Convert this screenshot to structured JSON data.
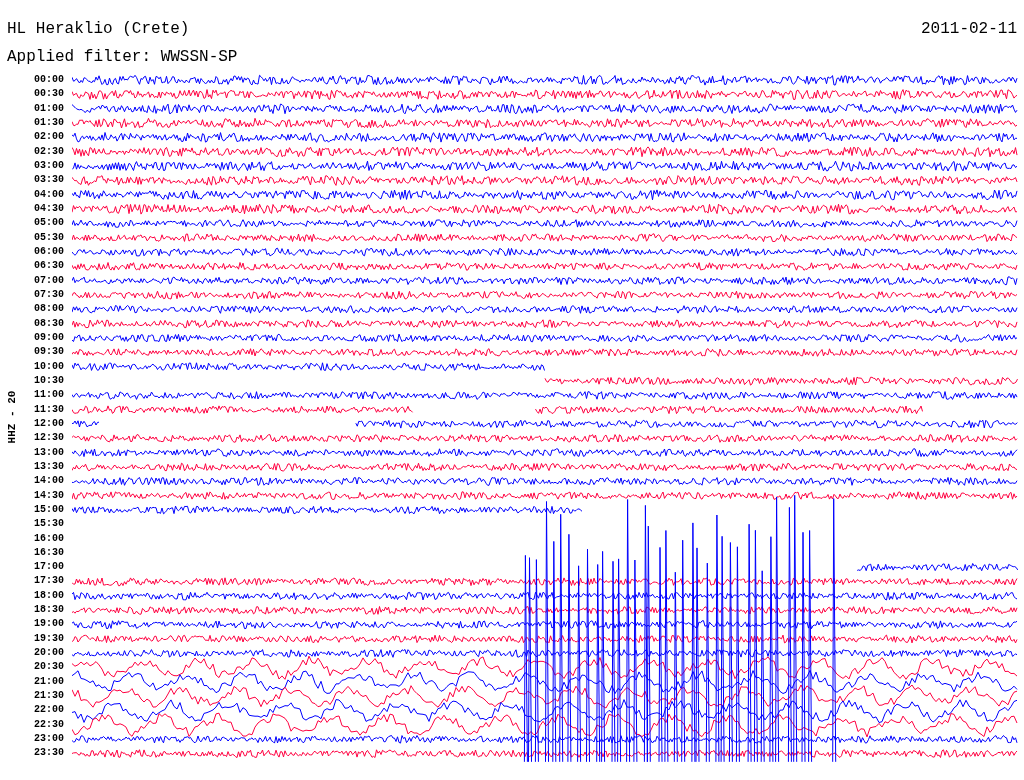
{
  "header": {
    "station": "HL Heraklio (Crete)",
    "date": "2011-02-11",
    "filter": "Applied filter: WWSSN-SP"
  },
  "channel_label": "HHZ - 20",
  "rows": [
    {
      "time": "00:00",
      "color": "#0000ff",
      "kind": "full"
    },
    {
      "time": "00:30",
      "color": "#ff0040",
      "kind": "full"
    },
    {
      "time": "01:00",
      "color": "#0000ff",
      "kind": "full"
    },
    {
      "time": "01:30",
      "color": "#ff0040",
      "kind": "full"
    },
    {
      "time": "02:00",
      "color": "#0000ff",
      "kind": "full"
    },
    {
      "time": "02:30",
      "color": "#ff0040",
      "kind": "full"
    },
    {
      "time": "03:00",
      "color": "#0000ff",
      "kind": "full"
    },
    {
      "time": "03:30",
      "color": "#ff0040",
      "kind": "full"
    },
    {
      "time": "04:00",
      "color": "#0000ff",
      "kind": "full"
    },
    {
      "time": "04:30",
      "color": "#ff0040",
      "kind": "full"
    },
    {
      "time": "05:00",
      "color": "#0000ff",
      "kind": "full"
    },
    {
      "time": "05:30",
      "color": "#ff0040",
      "kind": "full"
    },
    {
      "time": "06:00",
      "color": "#0000ff",
      "kind": "full"
    },
    {
      "time": "06:30",
      "color": "#ff0040",
      "kind": "full"
    },
    {
      "time": "07:00",
      "color": "#0000ff",
      "kind": "full"
    },
    {
      "time": "07:30",
      "color": "#ff0040",
      "kind": "full"
    },
    {
      "time": "08:00",
      "color": "#0000ff",
      "kind": "full"
    },
    {
      "time": "08:30",
      "color": "#ff0040",
      "kind": "full"
    },
    {
      "time": "09:00",
      "color": "#0000ff",
      "kind": "full"
    },
    {
      "time": "09:30",
      "color": "#ff0040",
      "kind": "full"
    },
    {
      "time": "10:00",
      "color": "#0000ff",
      "kind": "partial"
    },
    {
      "time": "10:30",
      "color": "#ff0040",
      "kind": "partial"
    },
    {
      "time": "11:00",
      "color": "#0000ff",
      "kind": "full"
    },
    {
      "time": "11:30",
      "color": "#ff0040",
      "kind": "partial"
    },
    {
      "time": "12:00",
      "color": "#0000ff",
      "kind": "partial"
    },
    {
      "time": "12:30",
      "color": "#ff0040",
      "kind": "full"
    },
    {
      "time": "13:00",
      "color": "#0000ff",
      "kind": "full"
    },
    {
      "time": "13:30",
      "color": "#ff0040",
      "kind": "full"
    },
    {
      "time": "14:00",
      "color": "#0000ff",
      "kind": "full"
    },
    {
      "time": "14:30",
      "color": "#ff0040",
      "kind": "full"
    },
    {
      "time": "15:00",
      "color": "#0000ff",
      "kind": "partial"
    },
    {
      "time": "15:30"
    },
    {
      "time": "16:00"
    },
    {
      "time": "16:30"
    },
    {
      "time": "17:00",
      "color": "#0000ff",
      "kind": "partial"
    },
    {
      "time": "17:30",
      "color": "#ff0040",
      "kind": "full"
    },
    {
      "time": "18:00",
      "color": "#0000ff",
      "kind": "full"
    },
    {
      "time": "18:30",
      "color": "#ff0040",
      "kind": "full"
    },
    {
      "time": "19:00",
      "color": "#0000ff",
      "kind": "full"
    },
    {
      "time": "19:30",
      "color": "#ff0040",
      "kind": "full"
    },
    {
      "time": "20:00",
      "color": "#0000ff",
      "kind": "full"
    },
    {
      "time": "20:30",
      "color": "#ff0040",
      "kind": "full"
    },
    {
      "time": "21:00",
      "color": "#0000ff",
      "kind": "full"
    },
    {
      "time": "21:30",
      "color": "#ff0040",
      "kind": "full"
    },
    {
      "time": "22:00",
      "color": "#0000ff",
      "kind": "full"
    },
    {
      "time": "22:30",
      "color": "#ff0040",
      "kind": "full"
    },
    {
      "time": "23:00",
      "color": "#0000ff",
      "kind": "full"
    },
    {
      "time": "23:30",
      "color": "#ff0040",
      "kind": "full"
    }
  ]
}
